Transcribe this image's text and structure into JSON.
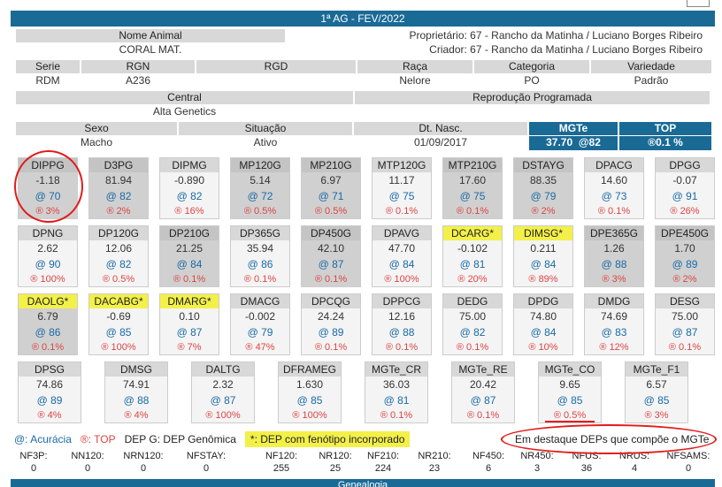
{
  "title": "1ª AG - FEV/2022",
  "animal": {
    "nome_label": "Nome Animal",
    "nome": "CORAL MAT.",
    "proprietario": "Proprietário: 67 - Rancho da Matinha / Luciano Borges Ribeiro",
    "criador": "Criador: 67 - Rancho da Matinha / Luciano Borges Ribeiro",
    "serie_label": "Serie",
    "serie": "RDM",
    "rgn_label": "RGN",
    "rgn": "A236",
    "rgd_label": "RGD",
    "rgd": "",
    "raca_label": "Raça",
    "raca": "Nelore",
    "categoria_label": "Categoria",
    "categoria": "PO",
    "variedade_label": "Variedade",
    "variedade": "Padrão",
    "central_label": "Central",
    "central": "Alta Genetics",
    "repro_label": "Reprodução Programada",
    "repro": "",
    "sexo_label": "Sexo",
    "sexo": "Macho",
    "situacao_label": "Situação",
    "situacao": "Ativo",
    "nasc_label": "Dt. Nasc.",
    "nasc": "01/09/2017",
    "mgte_label": "MGTe",
    "mgte": "37.70  @82",
    "top_label": "TOP",
    "top": "®0.1 %"
  },
  "deps": [
    {
      "n": "DIPPG",
      "v": "-1.18",
      "a": "@ 70",
      "t": "® 3%",
      "g": 1,
      "h": 0
    },
    {
      "n": "D3PG",
      "v": "81.94",
      "a": "@ 82",
      "t": "® 2%",
      "g": 1,
      "h": 0
    },
    {
      "n": "DIPMG",
      "v": "-0.890",
      "a": "@ 82",
      "t": "® 16%",
      "g": 0,
      "h": 0
    },
    {
      "n": "MP120G",
      "v": "5.14",
      "a": "@ 72",
      "t": "® 0.5%",
      "g": 1,
      "h": 0
    },
    {
      "n": "MP210G",
      "v": "6.97",
      "a": "@ 71",
      "t": "® 0.5%",
      "g": 1,
      "h": 0
    },
    {
      "n": "MTP120G",
      "v": "11.17",
      "a": "@ 75",
      "t": "® 0.1%",
      "g": 0,
      "h": 0
    },
    {
      "n": "MTP210G",
      "v": "17.60",
      "a": "@ 75",
      "t": "® 0.1%",
      "g": 1,
      "h": 0
    },
    {
      "n": "DSTAYG",
      "v": "88.35",
      "a": "@ 79",
      "t": "® 2%",
      "g": 1,
      "h": 0
    },
    {
      "n": "DPACG",
      "v": "14.60",
      "a": "@ 73",
      "t": "® 0.1%",
      "g": 0,
      "h": 0
    },
    {
      "n": "DPGG",
      "v": "-0.07",
      "a": "@ 91",
      "t": "® 26%",
      "g": 0,
      "h": 0
    },
    {
      "n": "DPNG",
      "v": "2.62",
      "a": "@ 90",
      "t": "® 100%",
      "g": 0,
      "h": 0
    },
    {
      "n": "DP120G",
      "v": "12.06",
      "a": "@ 82",
      "t": "® 0.5%",
      "g": 0,
      "h": 0
    },
    {
      "n": "DP210G",
      "v": "21.25",
      "a": "@ 84",
      "t": "® 0.1%",
      "g": 1,
      "h": 0
    },
    {
      "n": "DP365G",
      "v": "35.94",
      "a": "@ 86",
      "t": "® 0.1%",
      "g": 0,
      "h": 0
    },
    {
      "n": "DP450G",
      "v": "42.10",
      "a": "@ 87",
      "t": "® 0.1%",
      "g": 1,
      "h": 0
    },
    {
      "n": "DPAVG",
      "v": "47.70",
      "a": "@ 84",
      "t": "® 100%",
      "g": 0,
      "h": 0
    },
    {
      "n": "DCARG*",
      "v": "-0.102",
      "a": "@ 81",
      "t": "® 20%",
      "g": 0,
      "h": 1
    },
    {
      "n": "DIMSG*",
      "v": "0.211",
      "a": "@ 84",
      "t": "® 89%",
      "g": 0,
      "h": 1
    },
    {
      "n": "DPE365G",
      "v": "1.26",
      "a": "@ 88",
      "t": "® 3%",
      "g": 1,
      "h": 0
    },
    {
      "n": "DPE450G",
      "v": "1.70",
      "a": "@ 89",
      "t": "® 2%",
      "g": 1,
      "h": 0
    },
    {
      "n": "DAOLG*",
      "v": "6.79",
      "a": "@ 86",
      "t": "® 0.1%",
      "g": 1,
      "h": 1
    },
    {
      "n": "DACABG*",
      "v": "-0.69",
      "a": "@ 85",
      "t": "® 100%",
      "g": 0,
      "h": 1
    },
    {
      "n": "DMARG*",
      "v": "0.10",
      "a": "@ 87",
      "t": "® 7%",
      "g": 0,
      "h": 1
    },
    {
      "n": "DMACG",
      "v": "-0.002",
      "a": "@ 79",
      "t": "® 47%",
      "g": 0,
      "h": 0
    },
    {
      "n": "DPCQG",
      "v": "24.24",
      "a": "@ 89",
      "t": "® 0.1%",
      "g": 0,
      "h": 0
    },
    {
      "n": "DPPCG",
      "v": "12.16",
      "a": "@ 88",
      "t": "® 0.1%",
      "g": 0,
      "h": 0
    },
    {
      "n": "DEDG",
      "v": "75.00",
      "a": "@ 82",
      "t": "® 0.1%",
      "g": 0,
      "h": 0
    },
    {
      "n": "DPDG",
      "v": "74.80",
      "a": "@ 84",
      "t": "® 10%",
      "g": 0,
      "h": 0
    },
    {
      "n": "DMDG",
      "v": "74.69",
      "a": "@ 83",
      "t": "® 12%",
      "g": 0,
      "h": 0
    },
    {
      "n": "DESG",
      "v": "75.00",
      "a": "@ 87",
      "t": "® 0.1%",
      "g": 0,
      "h": 0
    },
    {
      "n": "DPSG",
      "v": "74.86",
      "a": "@ 89",
      "t": "® 4%",
      "g": 0,
      "h": 0
    },
    {
      "n": "DMSG",
      "v": "74.91",
      "a": "@ 88",
      "t": "® 4%",
      "g": 0,
      "h": 0
    },
    {
      "n": "DALTG",
      "v": "2.32",
      "a": "@ 87",
      "t": "® 100%",
      "g": 0,
      "h": 0
    },
    {
      "n": "DFRAMEG",
      "v": "1.630",
      "a": "@ 85",
      "t": "® 100%",
      "g": 0,
      "h": 0
    },
    {
      "n": "MGTe_CR",
      "v": "36.03",
      "a": "@ 81",
      "t": "® 0.1%",
      "g": 0,
      "h": 0
    },
    {
      "n": "MGTe_RE",
      "v": "20.42",
      "a": "@ 87",
      "t": "® 0.1%",
      "g": 0,
      "h": 0
    },
    {
      "n": "MGTe_CO",
      "v": "9.65",
      "a": "@ 85",
      "t": "® 0.5%",
      "g": 0,
      "h": 0
    },
    {
      "n": "MGTe_F1",
      "v": "6.57",
      "a": "@ 85",
      "t": "® 3%",
      "g": 0,
      "h": 0
    }
  ],
  "legend": {
    "acc": "@: Acurácia",
    "top": "®: TOP",
    "depg": "DEP G: DEP Genômica",
    "fen": "*: DEP com fenótipo incorporado",
    "destaque": "Em destaque DEPs que compõe o MGTe"
  },
  "nf": [
    {
      "l": "NF3P:",
      "v": "0"
    },
    {
      "l": "NN120:",
      "v": "0"
    },
    {
      "l": "NRN120:",
      "v": "0"
    },
    {
      "l": "NFSTAY:",
      "v": "0"
    },
    {
      "l": "NF120:",
      "v": "255"
    },
    {
      "l": "NR120:",
      "v": "25"
    },
    {
      "l": "NF210:",
      "v": "224"
    },
    {
      "l": "NR210:",
      "v": "23"
    },
    {
      "l": "NF450:",
      "v": "6"
    },
    {
      "l": "NR450:",
      "v": "3"
    },
    {
      "l": "NFUS:",
      "v": "36"
    },
    {
      "l": "NRUS:",
      "v": "4"
    },
    {
      "l": "NFSAMS:",
      "v": "0"
    }
  ],
  "footer": "Genealogia"
}
